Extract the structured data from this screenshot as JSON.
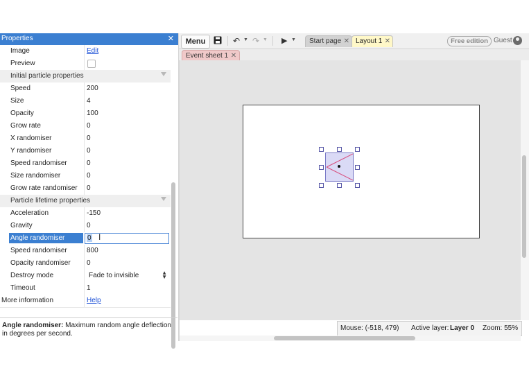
{
  "properties_panel": {
    "title": "Properties",
    "close_icon": "close-icon",
    "top_rows": [
      {
        "name": "Image",
        "value": "Edit",
        "type": "link"
      },
      {
        "name": "Preview",
        "value": "",
        "type": "checkbox"
      }
    ],
    "initial_section": {
      "title": "Initial particle properties",
      "rows": [
        {
          "name": "Speed",
          "value": "200"
        },
        {
          "name": "Size",
          "value": "4"
        },
        {
          "name": "Opacity",
          "value": "100"
        },
        {
          "name": "Grow rate",
          "value": "0"
        },
        {
          "name": "X randomiser",
          "value": "0"
        },
        {
          "name": "Y randomiser",
          "value": "0"
        },
        {
          "name": "Speed randomiser",
          "value": "0"
        },
        {
          "name": "Size randomiser",
          "value": "0"
        },
        {
          "name": "Grow rate randomiser",
          "value": "0"
        }
      ]
    },
    "lifetime_section": {
      "title": "Particle lifetime properties",
      "rows": [
        {
          "name": "Acceleration",
          "value": "-150"
        },
        {
          "name": "Gravity",
          "value": "0"
        },
        {
          "name": "Angle randomiser",
          "value": "0",
          "selected": true
        },
        {
          "name": "Speed randomiser",
          "value": "800"
        },
        {
          "name": "Opacity randomiser",
          "value": "0"
        },
        {
          "name": "Destroy mode",
          "value": "Fade to invisible",
          "type": "select"
        },
        {
          "name": "Timeout",
          "value": "1"
        }
      ]
    },
    "more_info": {
      "name": "More information",
      "value": "Help"
    },
    "description": {
      "label": "Angle randomiser:",
      "text": " Maximum random angle deflection in degrees per second."
    }
  },
  "toolbar": {
    "menu_label": "Menu",
    "icons": [
      "save-icon",
      "undo-icon",
      "redo-icon",
      "play-icon"
    ],
    "tabs": [
      {
        "label": "Start page",
        "active": false
      },
      {
        "label": "Layout 1",
        "active": true
      }
    ],
    "edition_badge": "Free edition",
    "user_label": "Guest"
  },
  "subtabs": [
    {
      "label": "Event sheet 1"
    }
  ],
  "status_bar": {
    "mouse": "Mouse: (-518, 479)",
    "active_layer_label": "Active layer:",
    "active_layer_value": "Layer 0",
    "zoom": "Zoom: 55%"
  },
  "colors": {
    "accent": "#3b7fd1",
    "layout_tab": "#fff8c8",
    "event_tab": "#f0c9c9",
    "canvas_bg": "#e4e4e4",
    "sprite_fill": "#dadaf6"
  }
}
